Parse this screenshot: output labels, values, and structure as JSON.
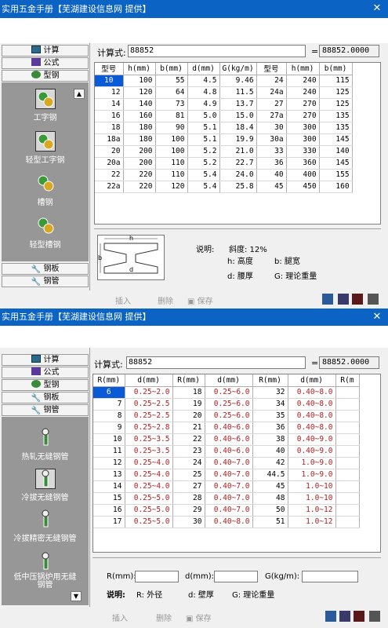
{
  "w1": {
    "title": "实用五金手册【芜湖建设信息网 提供】",
    "nav": [
      "计算",
      "公式",
      "型钢"
    ],
    "nav_bottom": [
      "钢板",
      "钢管"
    ],
    "shelf": [
      "工字钢",
      "轻型工字钢",
      "槽钢",
      "轻型槽钢"
    ],
    "formula_label": "计算式:",
    "formula_value": "88852",
    "eq": "=",
    "result": "88852.0000",
    "headers": [
      "型号",
      "h(mm)",
      "b(mm)",
      "d(mm)",
      "G(kg/m)",
      "型号",
      "h(mm)",
      "b(mm)"
    ],
    "rows": [
      [
        "10",
        "100",
        "55",
        "4.5",
        "9.46",
        "24",
        "240",
        "115"
      ],
      [
        "12",
        "120",
        "64",
        "4.8",
        "11.5",
        "24a",
        "240",
        "125"
      ],
      [
        "14",
        "140",
        "73",
        "4.9",
        "13.7",
        "27",
        "270",
        "125"
      ],
      [
        "16",
        "160",
        "81",
        "5.0",
        "15.0",
        "27a",
        "270",
        "135"
      ],
      [
        "18",
        "180",
        "90",
        "5.1",
        "18.4",
        "30",
        "300",
        "135"
      ],
      [
        "18a",
        "180",
        "100",
        "5.1",
        "19.9",
        "30a",
        "300",
        "145"
      ],
      [
        "20",
        "200",
        "100",
        "5.2",
        "21.0",
        "33",
        "330",
        "140"
      ],
      [
        "20a",
        "200",
        "110",
        "5.2",
        "22.7",
        "36",
        "360",
        "145"
      ],
      [
        "22",
        "220",
        "110",
        "5.4",
        "24.0",
        "40",
        "400",
        "155"
      ],
      [
        "22a",
        "220",
        "120",
        "5.4",
        "25.8",
        "45",
        "450",
        "160"
      ]
    ],
    "legend": {
      "title": "说明:",
      "slope": "斜度:  12%",
      "h": "h: 高度",
      "b": "b: 腿宽",
      "d": "d: 腰厚",
      "g": "G: 理论重量"
    },
    "diagram": {
      "h": "h",
      "b": "b",
      "d": "d"
    },
    "toolbar": {
      "insert": "插入",
      "delete": "删除",
      "save": "保存"
    }
  },
  "w2": {
    "title": "实用五金手册【芜湖建设信息网 提供】",
    "nav": [
      "计算",
      "公式",
      "型钢",
      "钢板",
      "钢管"
    ],
    "shelf": [
      "热轧无缝钢管",
      "冷拔无缝钢管",
      "冷拔精密无缝钢管",
      "低中压锅炉用无缝钢管"
    ],
    "formula_label": "计算式:",
    "formula_value": "88852",
    "eq": "=",
    "result": "88852.0000",
    "headers": [
      "R(mm)",
      "d(mm)",
      "R(mm)",
      "d(mm)",
      "R(mm)",
      "d(mm)",
      "R(m"
    ],
    "rows": [
      [
        "6",
        "0.25~2.0",
        "18",
        "0.25~6.0",
        "32",
        "0.40~8.0"
      ],
      [
        "7",
        "0.25~2.5",
        "19",
        "0.25~6.0",
        "34",
        "0.40~8.0"
      ],
      [
        "8",
        "0.25~2.5",
        "20",
        "0.25~6.0",
        "35",
        "0.40~8.0"
      ],
      [
        "9",
        "0.25~2.8",
        "21",
        "0.40~6.0",
        "36",
        "0.40~8.0"
      ],
      [
        "10",
        "0.25~3.5",
        "22",
        "0.40~6.0",
        "38",
        "0.40~9.0"
      ],
      [
        "11",
        "0.25~3.5",
        "23",
        "0.40~6.0",
        "40",
        "0.40~9.0"
      ],
      [
        "12",
        "0.25~4.0",
        "24",
        "0.40~7.0",
        "42",
        "1.0~9.0"
      ],
      [
        "13",
        "0.25~4.0",
        "25",
        "0.40~7.0",
        "44.5",
        "1.0~9.0"
      ],
      [
        "14",
        "0.25~4.0",
        "27",
        "0.40~7.0",
        "45",
        "1.0~10"
      ],
      [
        "15",
        "0.25~5.0",
        "28",
        "0.40~7.0",
        "48",
        "1.0~10"
      ],
      [
        "16",
        "0.25~5.0",
        "29",
        "0.40~7.0",
        "50",
        "1.0~12"
      ],
      [
        "17",
        "0.25~5.0",
        "30",
        "0.40~8.0",
        "51",
        "1.0~12"
      ]
    ],
    "inputs": {
      "r": "R(mm):",
      "d": "d(mm):",
      "g": "G(kg/m):"
    },
    "legend": {
      "title": "说明:",
      "r": "R: 外径",
      "d": "d: 壁厚",
      "g": "G: 理论重量"
    },
    "toolbar": {
      "insert": "插入",
      "delete": "删除",
      "save": "保存"
    }
  }
}
